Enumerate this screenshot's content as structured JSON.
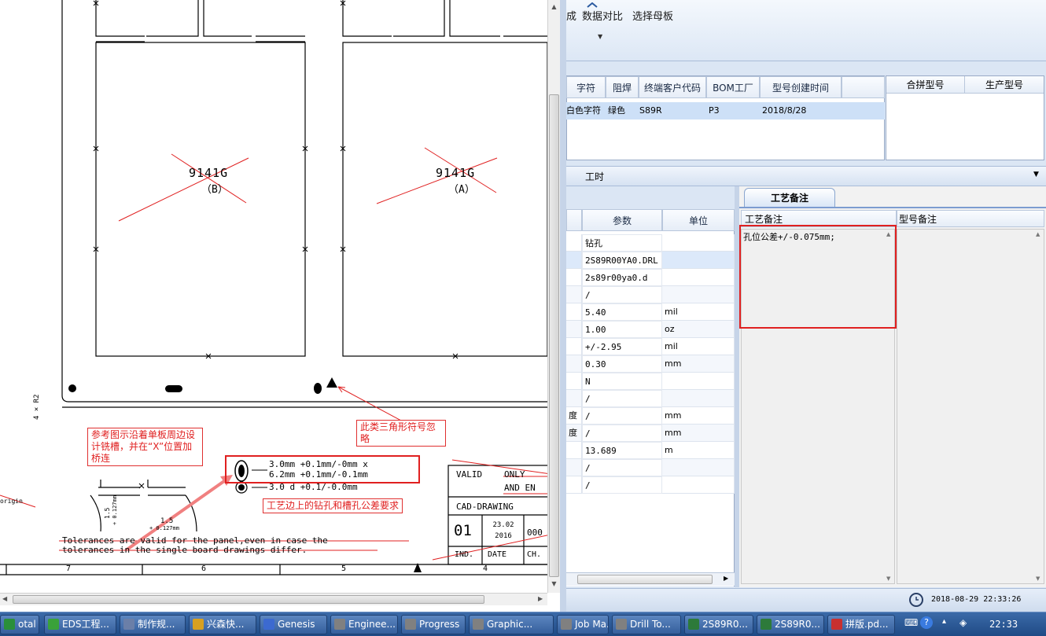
{
  "drawing": {
    "board_b": {
      "code": "9141G",
      "suffix": "（B）"
    },
    "board_a": {
      "code": "9141G",
      "suffix": "（A）"
    },
    "corner_radius_label": "4 × R2",
    "note_triangle": "此类三角形符号忽略",
    "note_bridge": "参考图示沿着单板周边设计铣槽，并在“X”位置加桥连",
    "note_holes": "工艺边上的钻孔和槽孔公差要求",
    "hole_spec_line1": "3.0mm +0.1mm/-0mm x",
    "hole_spec_line2": "6.2mm +0.1mm/-0.1mm",
    "hole_spec_line3": "3.0 d +0.1/-0.0mm",
    "tolerance_line1": "Tolerances are valid for the panel,even in case the",
    "tolerance_line2": "tolerances in the single board drawings differ.",
    "dim_15": "1.5",
    "dim_0127": "+ 0.127mm",
    "dim_15b": "1.5",
    "dim_0127b": "+ 0.127mm",
    "origin_label": "origin",
    "title_block": {
      "valid": "VALID",
      "only": "ONLY",
      "and_en": "AND EN",
      "cad": "CAD-DRAWING",
      "ind_value": "01",
      "date_value": "23.02 2016",
      "code_partial": "000",
      "ind": "IND.",
      "date": "DATE",
      "ch": "CH."
    },
    "ruler": [
      "7",
      "6",
      "5",
      "4"
    ]
  },
  "ribbon": {
    "partial": "成",
    "compare": "数据对比",
    "select_mother": "选择母板"
  },
  "top_grid": {
    "headers": [
      "字符",
      "阻焊",
      "终端客户代码",
      "BOM工厂",
      "型号创建时间"
    ],
    "row": [
      "白色字符",
      "绿色",
      "S89R",
      "P3",
      "2018/8/28"
    ],
    "right_headers": [
      "合拼型号",
      "生产型号"
    ]
  },
  "section_bar": {
    "label": "工时"
  },
  "params_grid": {
    "headers": [
      "参数",
      "单位"
    ],
    "rows": [
      {
        "label": "",
        "value": "钻孔",
        "unit": ""
      },
      {
        "label": "",
        "value": "2S89R00YA0.DRL",
        "unit": ""
      },
      {
        "label": "",
        "value": "2s89r00ya0.d",
        "unit": ""
      },
      {
        "label": "",
        "value": "/",
        "unit": ""
      },
      {
        "label": "",
        "value": "5.40",
        "unit": "mil"
      },
      {
        "label": "",
        "value": "1.00",
        "unit": "oz"
      },
      {
        "label": "",
        "value": "+/-2.95",
        "unit": "mil"
      },
      {
        "label": "",
        "value": "0.30",
        "unit": "mm"
      },
      {
        "label": "",
        "value": "N",
        "unit": ""
      },
      {
        "label": "",
        "value": "/",
        "unit": ""
      },
      {
        "label": "度",
        "value": "/",
        "unit": "mm"
      },
      {
        "label": "度",
        "value": "/",
        "unit": "mm"
      },
      {
        "label": "",
        "value": "13.689",
        "unit": "m"
      },
      {
        "label": "",
        "value": "/",
        "unit": ""
      },
      {
        "label": "",
        "value": "/",
        "unit": ""
      }
    ]
  },
  "notes_panel": {
    "tab": "工艺备注",
    "col1": "工艺备注",
    "col2": "型号备注",
    "process_note": "孔位公差+/-0.075mm;"
  },
  "status_time": "2018-08-29 22:33:26",
  "taskbar": {
    "items": [
      "otal C...",
      "EDS工程...",
      "制作规...",
      "兴森快...",
      "Genesis",
      "Enginee...",
      "Progress",
      "Graphic...",
      "Job Ma...",
      "Drill To...",
      "2S89R0...",
      "2S89R0...",
      "拼版.pd..."
    ],
    "clock": "22:33"
  }
}
